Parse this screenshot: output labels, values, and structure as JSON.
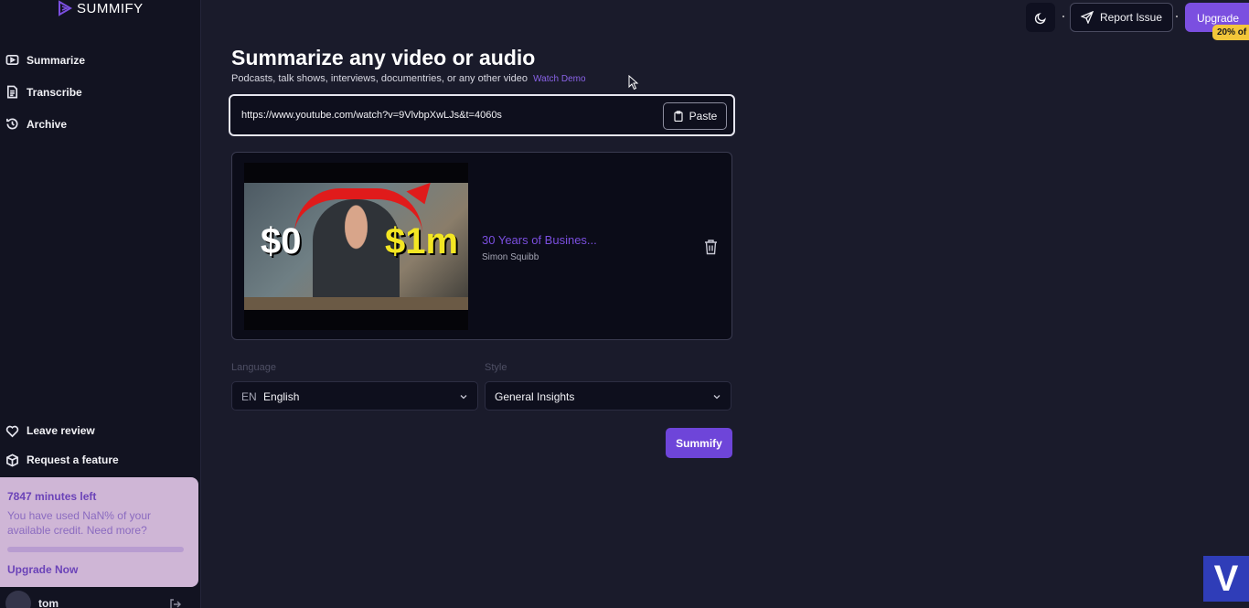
{
  "app": {
    "name": "SUMMIFY",
    "brand_color": "#7b4fe0"
  },
  "sidebar": {
    "items": [
      {
        "label": "Summarize",
        "icon": "play-square-icon"
      },
      {
        "label": "Transcribe",
        "icon": "document-icon"
      },
      {
        "label": "Archive",
        "icon": "history-icon"
      }
    ],
    "bottom_items": [
      {
        "label": "Leave review",
        "icon": "heart-icon"
      },
      {
        "label": "Request a feature",
        "icon": "puzzle-icon"
      }
    ],
    "credit": {
      "title": "7847 minutes left",
      "description": "You have used NaN% of your available credit. Need more?",
      "upgrade_label": "Upgrade Now"
    },
    "user": {
      "name": "tom"
    }
  },
  "topbar": {
    "report_label": "Report Issue",
    "upgrade_label": "Upgrade",
    "discount_badge": "20% of"
  },
  "main": {
    "title": "Summarize any video or audio",
    "subtitle": "Podcasts, talk shows, interviews, documentries, or any other video",
    "watch_demo": "Watch Demo",
    "url_value": "https://www.youtube.com/watch?v=9VlvbpXwLJs&t=4060s",
    "paste_label": "Paste",
    "video": {
      "title": "30 Years of Busines...",
      "channel": "Simon Squibb",
      "thumb_left_text": "$0",
      "thumb_right_text": "$1m"
    },
    "language": {
      "label": "Language",
      "prefix": "EN",
      "value": "English"
    },
    "style": {
      "label": "Style",
      "value": "General Insights"
    },
    "submit_label": "Summify"
  },
  "corner_logo": "V"
}
